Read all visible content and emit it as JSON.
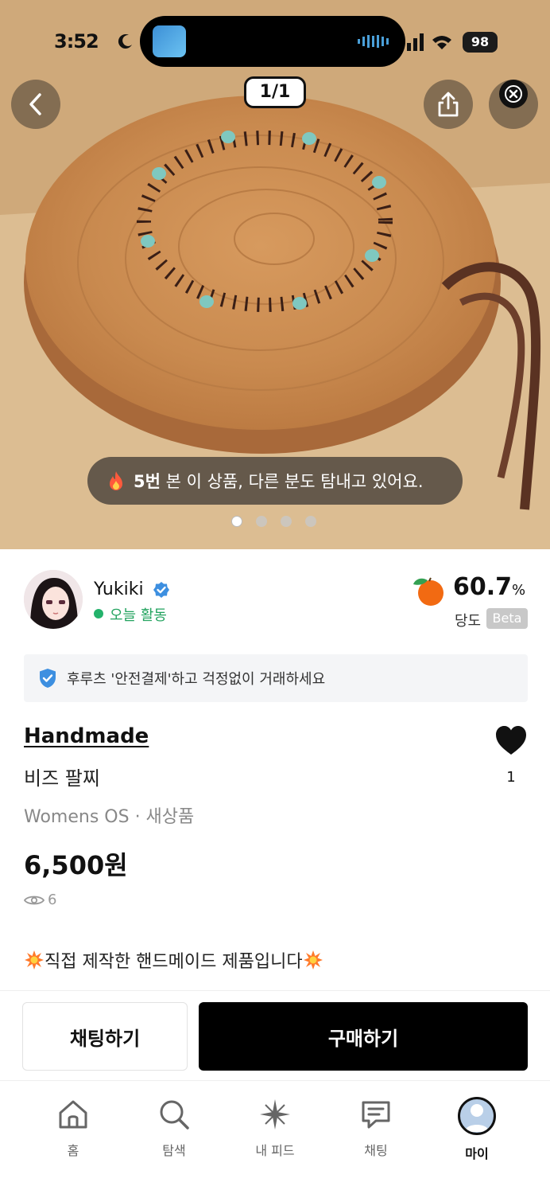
{
  "status": {
    "time": "3:52",
    "battery": "98"
  },
  "hero": {
    "page_indicator": "1/1",
    "toast_bold": "5번",
    "toast_rest": " 본 이 상품, 다른 분도 탐내고 있어요.",
    "dots": 4,
    "active_dot": 0
  },
  "seller": {
    "name": "Yukiki",
    "activity": "오늘 활동",
    "temperature_value": "60.7",
    "temperature_unit": "%",
    "temperature_label": "당도",
    "beta_badge": "Beta"
  },
  "safe_payment": {
    "text": "후루츠 '안전결제'하고 걱정없이 거래하세요"
  },
  "product": {
    "category": "Handmade",
    "title": "비즈 팔찌",
    "meta": "Womens OS · 새상품",
    "price": "6,500원",
    "views": "6",
    "likes": "1",
    "description": "직접 제작한 핸드메이드 제품입니다"
  },
  "actions": {
    "chat_label": "채팅하기",
    "buy_label": "구매하기"
  },
  "tabbar": {
    "items": [
      {
        "label": "홈",
        "icon": "home-icon"
      },
      {
        "label": "탐색",
        "icon": "search-icon"
      },
      {
        "label": "내 피드",
        "icon": "sparkle-icon"
      },
      {
        "label": "채팅",
        "icon": "chat-icon"
      },
      {
        "label": "마이",
        "icon": "profile-icon"
      }
    ],
    "active_index": 4
  },
  "colors": {
    "accent": "#23b26b",
    "verified": "#3d8fe0",
    "primary_button": "#000000"
  }
}
